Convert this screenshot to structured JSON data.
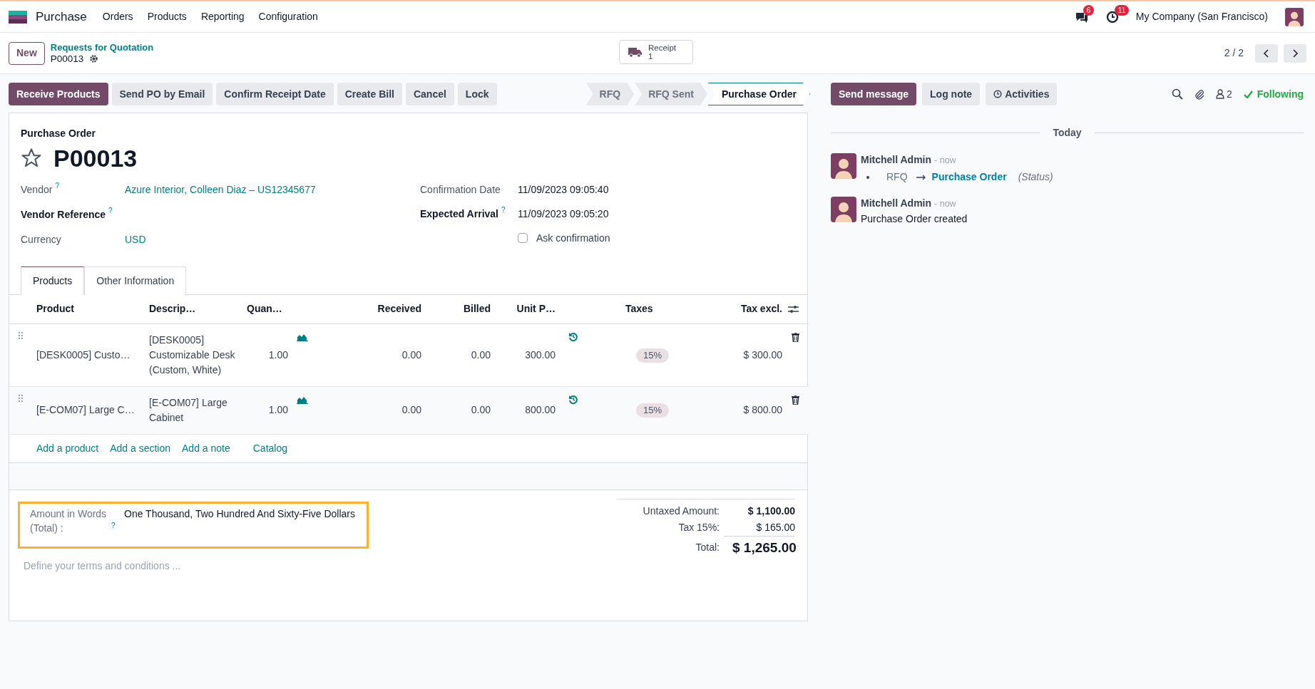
{
  "navbar": {
    "app_name": "Purchase",
    "menu": [
      "Orders",
      "Products",
      "Reporting",
      "Configuration"
    ],
    "messages_count": "6",
    "activities_count": "11",
    "company": "My Company (San Francisco)"
  },
  "control_panel": {
    "new_button": "New",
    "breadcrumb": "Requests for Quotation",
    "record": "P00013",
    "smart_button": {
      "label": "Receipt",
      "count": "1"
    },
    "pager": "2 / 2"
  },
  "actions": [
    {
      "label": "Receive Products",
      "primary": true
    },
    {
      "label": "Send PO by Email",
      "primary": false
    },
    {
      "label": "Confirm Receipt Date",
      "primary": false
    },
    {
      "label": "Create Bill",
      "primary": false
    },
    {
      "label": "Cancel",
      "primary": false
    },
    {
      "label": "Lock",
      "primary": false
    }
  ],
  "statusbar": [
    {
      "label": "RFQ",
      "selected": false
    },
    {
      "label": "RFQ Sent",
      "selected": false
    },
    {
      "label": "Purchase Order",
      "selected": true
    }
  ],
  "sheet": {
    "caption": "Purchase Order",
    "name": "P00013",
    "starred": false,
    "left_fields": [
      {
        "label": "Vendor",
        "help": "?",
        "required": false,
        "value": "Azure Interior, Colleen Diaz – US12345677"
      },
      {
        "label": "Vendor Reference",
        "help": "?",
        "required": true
      },
      {
        "label": "Currency",
        "required": false,
        "value": "USD"
      }
    ],
    "right_fields": [
      {
        "label": "Confirmation Date",
        "required": false,
        "value": "11/09/2023 09:05:40"
      },
      {
        "label": "Expected Arrival",
        "help": "?",
        "required": true,
        "value": "11/09/2023 09:05:20"
      }
    ],
    "ask_confirmation": {
      "label": "Ask confirmation",
      "checked": false
    },
    "tabs": [
      {
        "label": "Products",
        "selected": true
      },
      {
        "label": "Other Information",
        "selected": false
      }
    ],
    "table": {
      "columns": [
        "Product",
        "Descrip…",
        "Quan…",
        "Received",
        "Billed",
        "Unit P…",
        "Taxes",
        "Tax excl."
      ],
      "rows": [
        {
          "product": "[DESK0005] Custo…",
          "description": "[DESK0005] Customizable Desk (Custom, White)",
          "quantity": "1.00",
          "received": "0.00",
          "billed": "0.00",
          "unit_price": "300.00",
          "tax": "15%",
          "subtotal": "$ 300.00"
        },
        {
          "product": "[E-COM07] Large C…",
          "description": "[E-COM07] Large Cabinet",
          "quantity": "1.00",
          "received": "0.00",
          "billed": "0.00",
          "unit_price": "800.00",
          "tax": "15%",
          "subtotal": "$ 800.00"
        }
      ]
    },
    "add_links": [
      "Add a product",
      "Add a section",
      "Add a note",
      "Catalog"
    ],
    "amount_in_words": {
      "label": "Amount in Words (Total) :",
      "help": "?",
      "value": "One Thousand, Two Hundred And Sixty-Five Dollars"
    },
    "terms_placeholder": "Define your terms and conditions ...",
    "totals": [
      {
        "label": "Untaxed Amount:",
        "value": "$ 1,100.00",
        "kind": "subtotal"
      },
      {
        "label": "Tax 15%:",
        "value": "$ 165.00",
        "kind": "tax"
      },
      {
        "label": "Total:",
        "value": "$ 1,265.00",
        "kind": "total"
      }
    ]
  },
  "chatter": {
    "buttons": [
      {
        "label": "Send message",
        "primary": true
      },
      {
        "label": "Log note",
        "primary": false
      },
      {
        "label": "Activities",
        "primary": false
      }
    ],
    "followers_count": "2",
    "following": "Following",
    "date_separator": "Today",
    "messages": [
      {
        "kind": "tracking",
        "author": "Mitchell Admin",
        "time": "- now",
        "old_value": "RFQ",
        "new_value": "Purchase Order",
        "field": "(Status)"
      },
      {
        "kind": "text",
        "author": "Mitchell Admin",
        "time": "- now",
        "body": "Purchase Order created"
      }
    ]
  }
}
